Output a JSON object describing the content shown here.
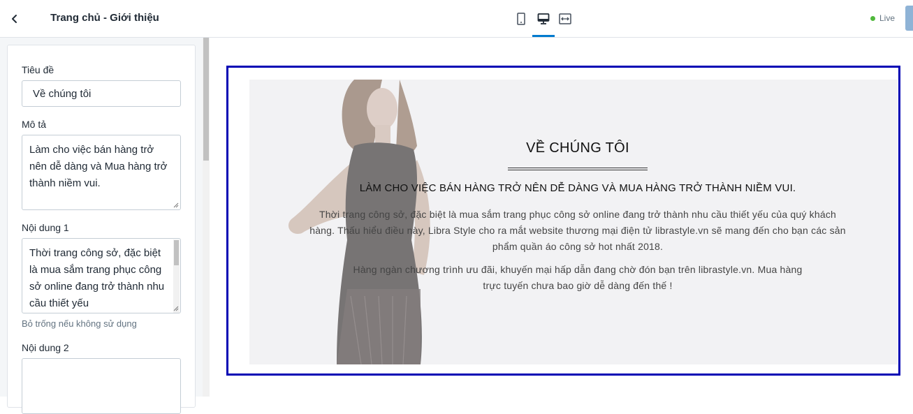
{
  "sidebar": {
    "title": "Trang chủ - Giới thiệu",
    "fields": {
      "title_label": "Tiêu đề",
      "title_value": "Về chúng tôi",
      "desc_label": "Mô tả",
      "desc_value": "Làm cho việc bán hàng trở nên dễ dàng và Mua hàng trở thành niềm vui.",
      "content1_label": "Nội dung 1",
      "content1_value": "Thời trang công sở, đặc biệt là mua sắm trang phục công sở online đang trở thành nhu cầu thiết yếu",
      "content1_hint": "Bỏ trống nếu không sử dụng",
      "content2_label": "Nội dung 2",
      "content2_value": ""
    }
  },
  "topbar": {
    "devices": [
      {
        "name": "mobile",
        "icon": "mobile-icon"
      },
      {
        "name": "desktop",
        "icon": "desktop-icon",
        "active": true
      },
      {
        "name": "fullwidth",
        "icon": "expand-horizontal-icon"
      }
    ],
    "live_label": "Live"
  },
  "preview": {
    "heading": "VỀ CHÚNG TÔI",
    "subheading": "LÀM CHO VIỆC BÁN HÀNG TRỞ NÊN DỄ DÀNG VÀ MUA HÀNG TRỞ THÀNH NIỀM VUI.",
    "paragraph1": "Thời trang công sở, đặc biệt là mua sắm trang phục công sở online đang trở thành nhu cầu thiết yếu của quý khách hàng. Thấu hiểu điều này, Libra Style cho ra mắt website thương mại điện tử librastyle.vn sẽ mang đến cho bạn các sản phẩm quần áo công sở hot nhất 2018.",
    "paragraph2": "Hàng ngàn chương trình ưu đãi, khuyến mại hấp dẫn đang chờ đón bạn trên librastyle.vn. Mua hàng trực tuyến chưa bao giờ dễ dàng đến thế !"
  },
  "colors": {
    "accent": "#007ace",
    "frame": "#0000b4",
    "live": "#50b83c"
  }
}
